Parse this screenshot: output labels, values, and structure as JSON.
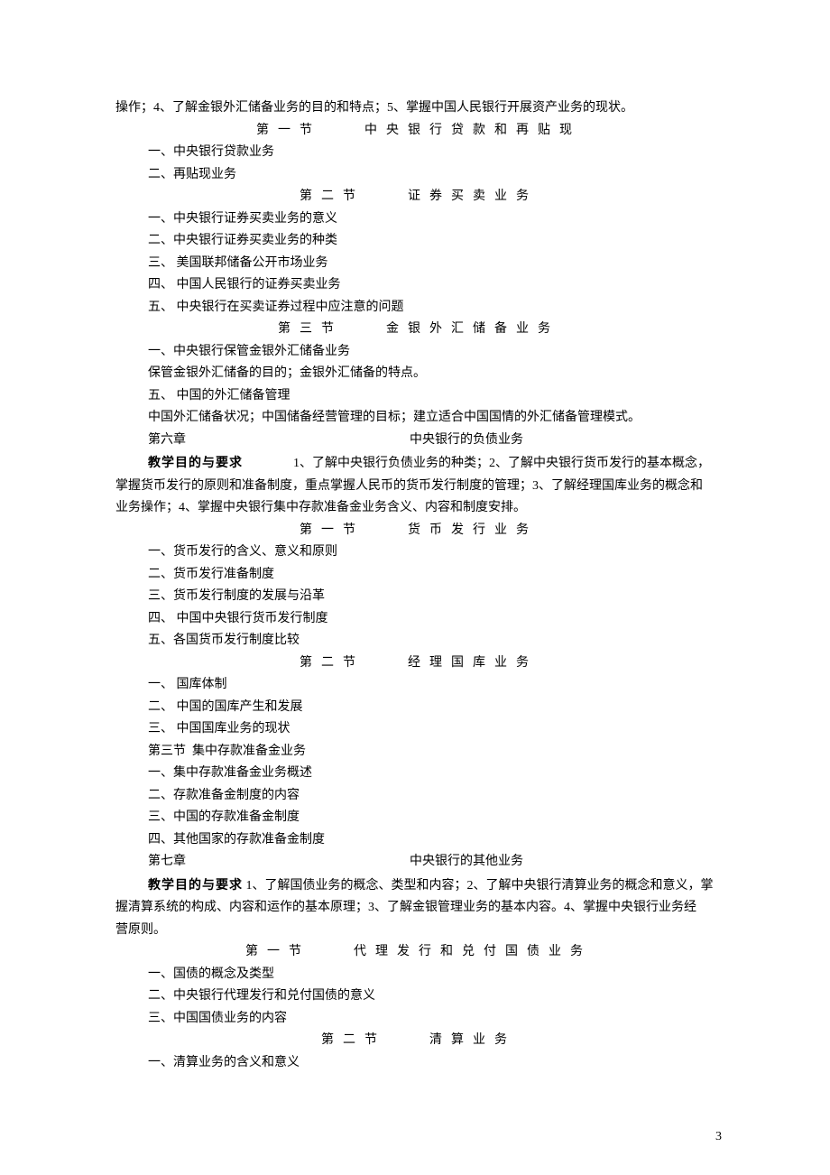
{
  "intro_tail": "操作；4、了解金银外汇储备业务的目的和特点；5、掌握中国人民银行开展资产业务的现状。",
  "c5s1_title": "第一节　　中央银行贷款和再贴现",
  "c5s1_1": "一、中央银行贷款业务",
  "c5s1_2": "二、再贴现业务",
  "c5s2_title": "第二节　　证券买卖业务",
  "c5s2_1": "一、中央银行证券买卖业务的意义",
  "c5s2_2": "二、中央银行证券买卖业务的种类",
  "c5s2_3": "三、 美国联邦储备公开市场业务",
  "c5s2_4": "四、 中国人民银行的证券买卖业务",
  "c5s2_5": "五、 中央银行在买卖证券过程中应注意的问题",
  "c5s3_title": "第三节　　金银外汇储备业务",
  "c5s3_1": "一、中央银行保管金银外汇储备业务",
  "c5s3_2": "保管金银外汇储备的目的；金银外汇储备的特点。",
  "c5s3_3": "五、 中国的外汇储备管理",
  "c5s3_4": "中国外汇储备状况；中国储备经营管理的目标；建立适合中国国情的外汇储备管理模式。",
  "c6_num": "第六章",
  "c6_name": "中央银行的负债业务",
  "c6_req_label": "教学目的与要求",
  "c6_req_a": "　　　　1、了解中央银行负债业务的种类；2、了解中央银行货币发行的基本概念，",
  "c6_req_b": "掌握货币发行的原则和准备制度，重点掌握人民币的货币发行制度的管理；3、了解经理国库业务的概念和",
  "c6_req_c": "业务操作；4、掌握中央银行集中存款准备金业务含义、内容和制度安排。",
  "c6s1_title": "第一节　　货币发行业务",
  "c6s1_1": "一、货币发行的含义、意义和原则",
  "c6s1_2": "二、货币发行准备制度",
  "c6s1_3": "三、货币发行制度的发展与沿革",
  "c6s1_4": "四、 中国中央银行货币发行制度",
  "c6s1_5": "五、各国货币发行制度比较",
  "c6s2_title": "第二节　　经理国库业务",
  "c6s2_1": "一、 国库体制",
  "c6s2_2": "二、 中国的国库产生和发展",
  "c6s2_3": "三、 中国国库业务的现状",
  "c6s3_title": "第三节  集中存款准备金业务",
  "c6s3_1": "一、集中存款准备金业务概述",
  "c6s3_2": "二、存款准备金制度的内容",
  "c6s3_3": "三、中国的存款准备金制度",
  "c6s3_4": "四、其他国家的存款准备金制度",
  "c7_num": "第七章",
  "c7_name": "中央银行的其他业务",
  "c7_req_label": "教学目的与要求",
  "c7_req_a": " 1、了解国债业务的概念、类型和内容；2、了解中央银行清算业务的概念和意义，掌",
  "c7_req_b": "握清算系统的构成、内容和运作的基本原理；3、了解金银管理业务的基本内容。4、掌握中央银行业务经",
  "c7_req_c": "营原则。",
  "c7s1_title": "第一节　　代理发行和兑付国债业务",
  "c7s1_1": "一、国债的概念及类型",
  "c7s1_2": "二、中央银行代理发行和兑付国债的意义",
  "c7s1_3": "三、中国国债业务的内容",
  "c7s2_title": "第二节　　清算业务",
  "c7s2_1": "一、清算业务的含义和意义",
  "page_number": "3"
}
